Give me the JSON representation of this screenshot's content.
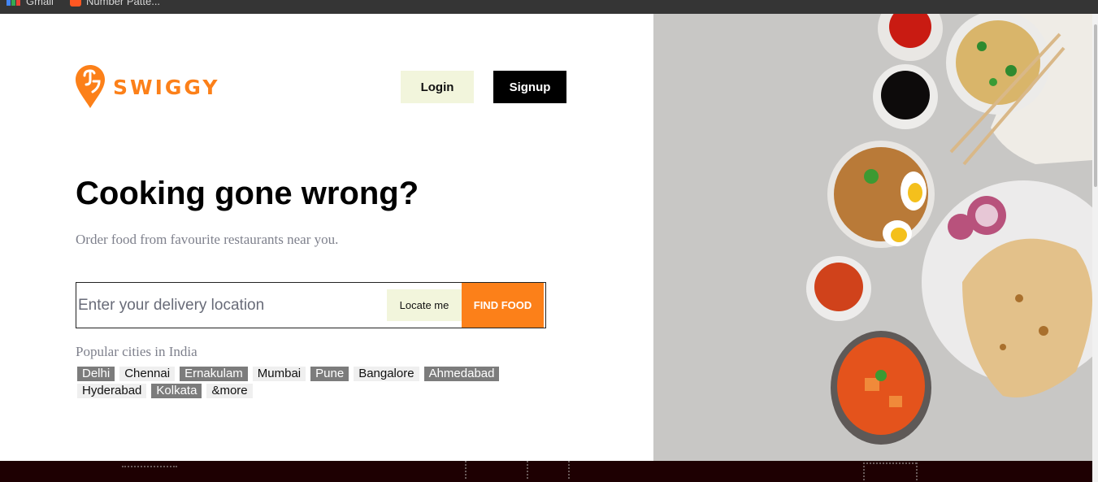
{
  "bookmarks": [
    {
      "label": "Gmail",
      "icon": "gmail-icon"
    },
    {
      "label": "Number Patte...",
      "icon": "bookmark-favicon"
    }
  ],
  "brand": {
    "name": "SWIGGY",
    "color": "#fc8019",
    "icon": "swiggy-logo-icon"
  },
  "header": {
    "login_label": "Login",
    "signup_label": "Signup"
  },
  "hero": {
    "headline": "Cooking gone wrong?",
    "subtitle": "Order food from favourite restaurants near you."
  },
  "search": {
    "placeholder": "Enter your delivery location",
    "value": "",
    "locate_label": "Locate me",
    "find_label": "FIND FOOD"
  },
  "popular": {
    "heading": "Popular cities in India",
    "cities": [
      "Delhi",
      "Chennai",
      "Ernakulam",
      "Mumbai",
      "Pune",
      "Bangalore",
      "Ahmedabad",
      "Hyderabad",
      "Kolkata",
      "&more"
    ]
  },
  "colors": {
    "accent": "#fc8019",
    "locate_bg": "#f2f5dc",
    "signup_bg": "#000000",
    "city_dark": "#7c7c7c"
  }
}
